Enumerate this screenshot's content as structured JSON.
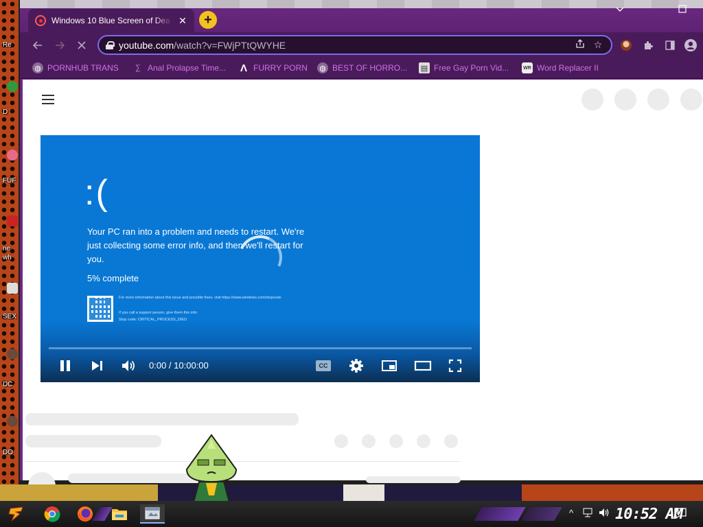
{
  "desktop": {
    "labels": [
      "Re",
      "D",
      "FUF",
      "ne",
      "wh",
      "SEX",
      "DC",
      "DO"
    ]
  },
  "browser": {
    "tab": {
      "title": "Windows 10 Blue Screen of Dea"
    },
    "window_controls": {
      "minimize": "—",
      "maximize": "□"
    },
    "address_bar": {
      "host": "youtube.com",
      "path": "/watch?v=FWjPTtQWYHE"
    },
    "bookmarks": [
      {
        "label": "PORNHUB TRANS",
        "icon": "globe-icon"
      },
      {
        "label": "Anal Prolapse Time...",
        "icon": "bookmark-icon"
      },
      {
        "label": "FURRY PORN",
        "icon": "lambda-icon"
      },
      {
        "label": "BEST OF HORRO...",
        "icon": "globe-icon"
      },
      {
        "label": "Free Gay Porn Vid...",
        "icon": "site-icon"
      },
      {
        "label": "Word Replacer II",
        "icon": "wr-icon"
      }
    ]
  },
  "video": {
    "bsod_face": ":(",
    "bsod_message": "Your PC ran into a problem and needs to restart. We're just collecting some error info, and then we'll restart for you.",
    "bsod_progress": "5% complete",
    "bsod_info": "For more information about this issue and possible fixes, visit https://www.windows.com/stopcode",
    "bsod_support": "If you call a support person, give them this info:",
    "bsod_stopcode": "Stop code: CRITICAL_PROCESS_DIED",
    "current_time": "0:00",
    "separator": " / ",
    "duration": "10:00:00",
    "progress": 0.0,
    "cc_label": "CC"
  },
  "taskbar": {
    "clock": "10:52 AM"
  }
}
